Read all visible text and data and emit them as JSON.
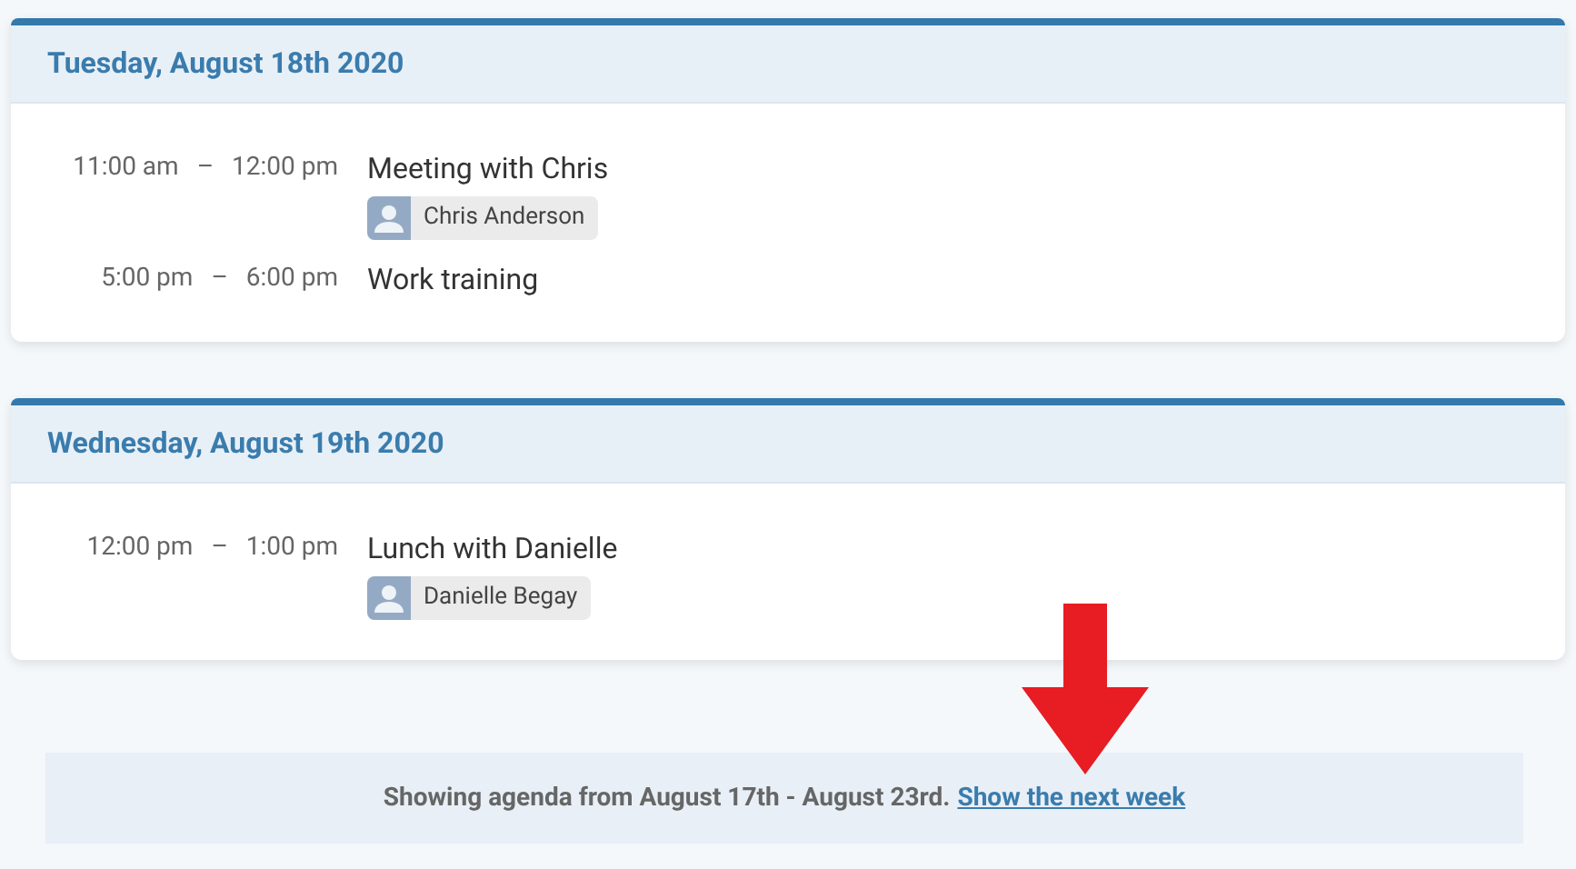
{
  "days": [
    {
      "heading": "Tuesday, August 18th 2020",
      "events": [
        {
          "start": "11:00 am",
          "separator": "–",
          "end": "12:00 pm",
          "title": "Meeting with Chris",
          "attendees": [
            "Chris Anderson"
          ]
        },
        {
          "start": "5:00 pm",
          "separator": "–",
          "end": "6:00 pm",
          "title": "Work training"
        }
      ]
    },
    {
      "heading": "Wednesday, August 19th 2020",
      "events": [
        {
          "start": "12:00 pm",
          "separator": "–",
          "end": "1:00 pm",
          "title": "Lunch with Danielle",
          "attendees": [
            "Danielle Begay"
          ]
        }
      ]
    }
  ],
  "footer": {
    "text": "Showing agenda from August 17th - August 23rd.",
    "link": "Show the next week"
  }
}
